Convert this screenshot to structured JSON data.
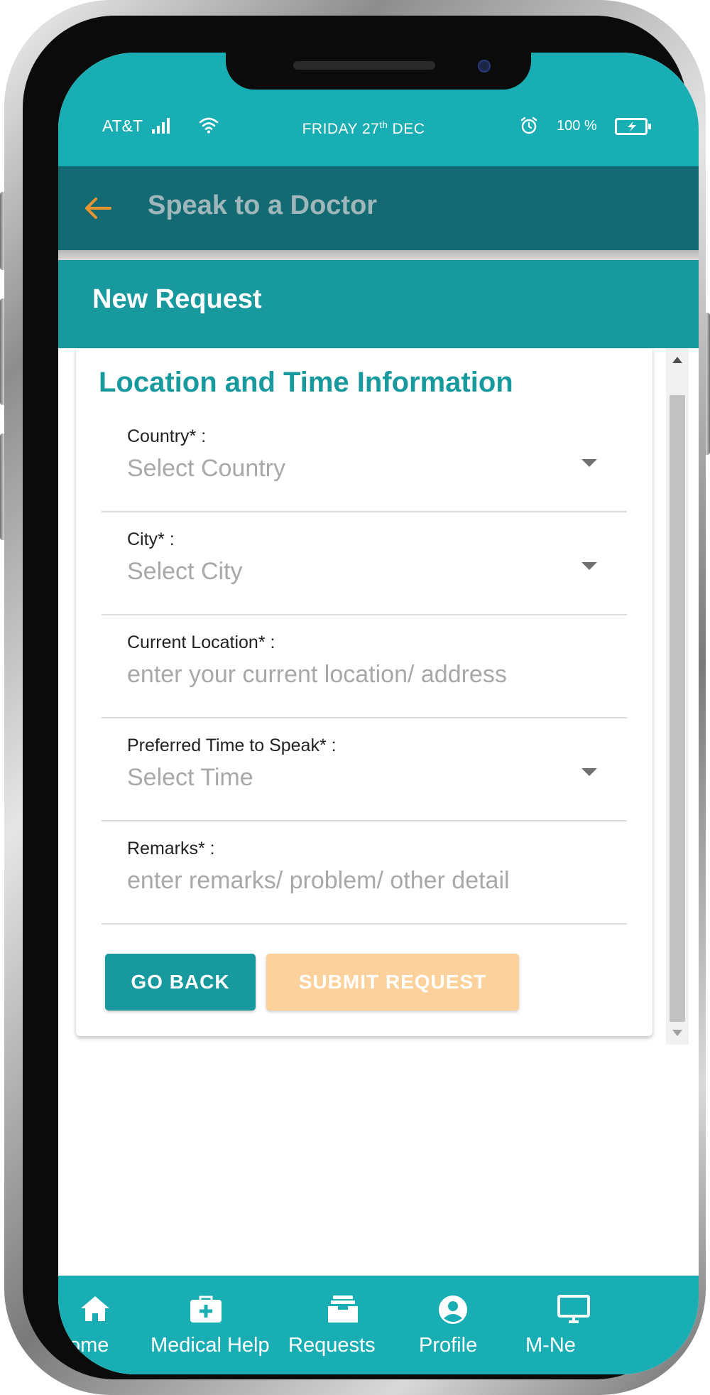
{
  "status_bar": {
    "carrier": "AT&T",
    "date_main": "FRIDAY 27",
    "date_sup": "th",
    "date_month": " DEC",
    "battery": "100 %"
  },
  "header": {
    "title": "Speak to a Doctor"
  },
  "banner": {
    "title": "New Request"
  },
  "form": {
    "section_title": "Location and Time Information",
    "fields": [
      {
        "label": "Country* :",
        "value": "Select Country"
      },
      {
        "label": "City* :",
        "value": "Select City"
      },
      {
        "label": "Current Location* :",
        "value": "enter your current location/ address"
      },
      {
        "label": "Preferred Time to Speak* :",
        "value": "Select Time"
      },
      {
        "label": "Remarks* :",
        "value": "enter remarks/ problem/ other detail"
      }
    ],
    "go_back_label": "GO BACK",
    "submit_label": "SUBMIT REQUEST"
  },
  "nav": {
    "items": [
      {
        "label": "Home",
        "icon": "home-icon"
      },
      {
        "label": "Medical Help",
        "icon": "medical-kit-icon"
      },
      {
        "label": "Requests",
        "icon": "inbox-tray-icon"
      },
      {
        "label": "Profile",
        "icon": "user-icon"
      },
      {
        "label": "M-Ne",
        "icon": "monitor-icon"
      }
    ]
  },
  "colors": {
    "primary": "#17999e",
    "status_bar": "#19aeb3",
    "header": "#146a72",
    "accent": "#e89530",
    "submit_disabled": "#fcd19b"
  }
}
